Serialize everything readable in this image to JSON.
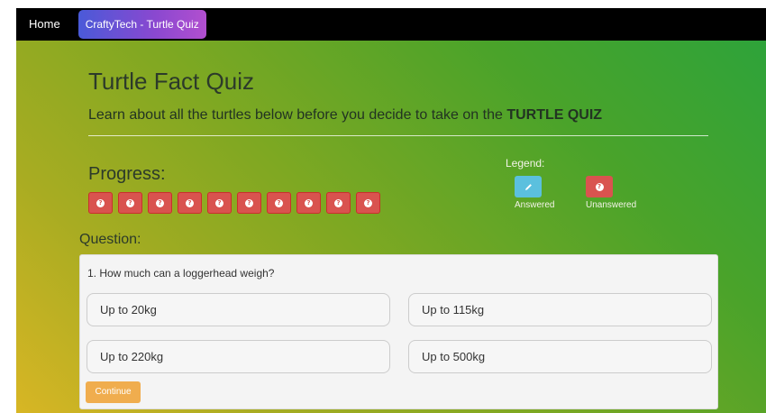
{
  "nav": {
    "home": "Home",
    "active_tab": "CraftyTech - Turtle Quiz"
  },
  "header": {
    "title": "Turtle Fact Quiz",
    "subtitle_pre": "Learn about all the turtles below before you decide to take on the ",
    "subtitle_bold": "TURTLE QUIZ"
  },
  "progress": {
    "label": "Progress:",
    "items": [
      {
        "status": "unanswered",
        "icon": "question-circle-icon"
      },
      {
        "status": "unanswered",
        "icon": "question-circle-icon"
      },
      {
        "status": "unanswered",
        "icon": "question-circle-icon"
      },
      {
        "status": "unanswered",
        "icon": "question-circle-icon"
      },
      {
        "status": "unanswered",
        "icon": "question-circle-icon"
      },
      {
        "status": "unanswered",
        "icon": "question-circle-icon"
      },
      {
        "status": "unanswered",
        "icon": "question-circle-icon"
      },
      {
        "status": "unanswered",
        "icon": "question-circle-icon"
      },
      {
        "status": "unanswered",
        "icon": "question-circle-icon"
      },
      {
        "status": "unanswered",
        "icon": "question-circle-icon"
      }
    ]
  },
  "legend": {
    "label": "Legend:",
    "answered": "Answered",
    "unanswered": "Unanswered"
  },
  "question": {
    "label": "Question:",
    "text": "1. How much can a loggerhead weigh?",
    "answers": [
      "Up to 20kg",
      "Up to 115kg",
      "Up to 220kg",
      "Up to 500kg"
    ],
    "continue": "Continue"
  },
  "colors": {
    "nav_bg": "#000000",
    "danger": "#d9534f",
    "info": "#5bc0de",
    "warning": "#f0ad4e"
  }
}
